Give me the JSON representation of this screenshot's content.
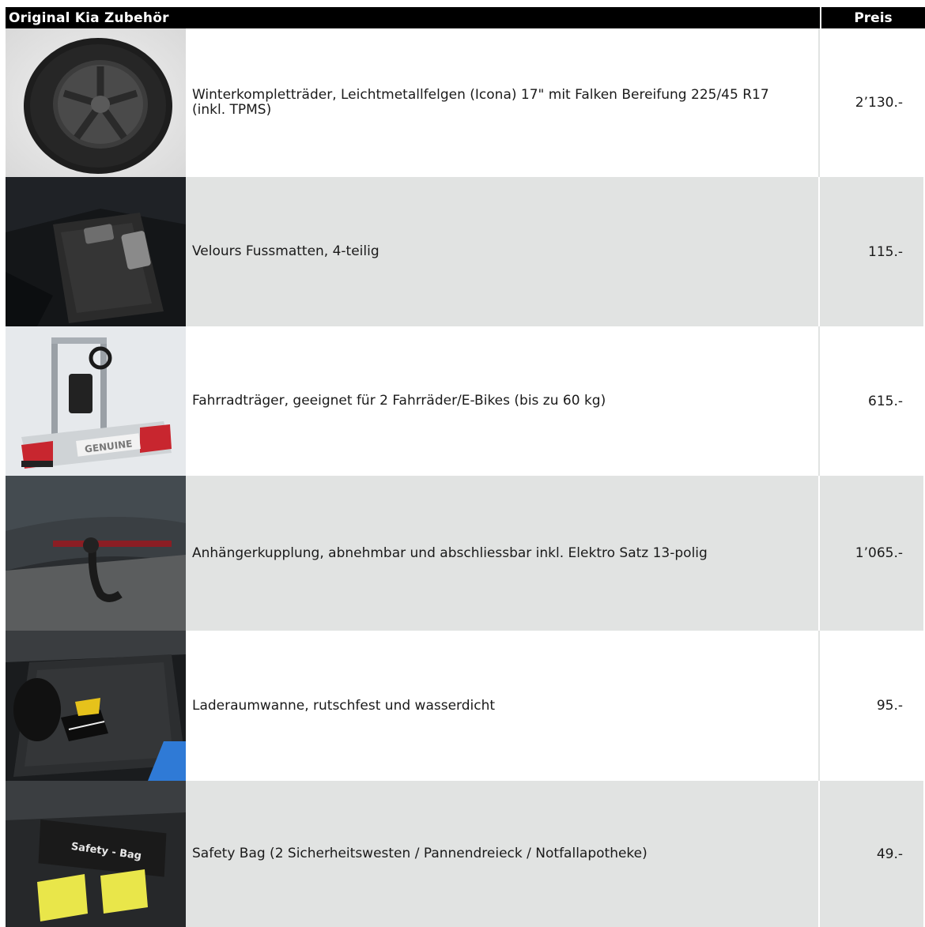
{
  "table": {
    "header": {
      "item": "Original Kia Zubehör",
      "price": "Preis"
    },
    "rows": [
      {
        "image": "alloy-wheel-image",
        "description": "Winterkompletträder, Leichtmetallfelgen (Icona) 17\" mit Falken Bereifung 225/45 R17 (inkl. TPMS)",
        "price": "2’130.-"
      },
      {
        "image": "floor-mats-image",
        "description": "Velours Fussmatten, 4-teilig",
        "price": "115.-"
      },
      {
        "image": "bike-carrier-image",
        "description": "Fahrradträger, geeignet für 2 Fahrräder/E-Bikes (bis zu 60 kg)",
        "price": "615.-"
      },
      {
        "image": "tow-hitch-image",
        "description": "Anhängerkupplung, abnehmbar und abschliessbar inkl. Elektro Satz 13-polig",
        "price": "1’065.-"
      },
      {
        "image": "cargo-tray-image",
        "description": "Laderaumwanne, rutschfest und wasserdicht",
        "price": "95.-"
      },
      {
        "image": "safety-bag-image",
        "description": "Safety Bag (2 Sicherheitswesten / Pannendreieck / Notfallapotheke)",
        "price": "49.-"
      }
    ],
    "image_text": {
      "bike_carrier_label": "GENUINE",
      "safety_bag_label": "Safety - Bag"
    }
  }
}
